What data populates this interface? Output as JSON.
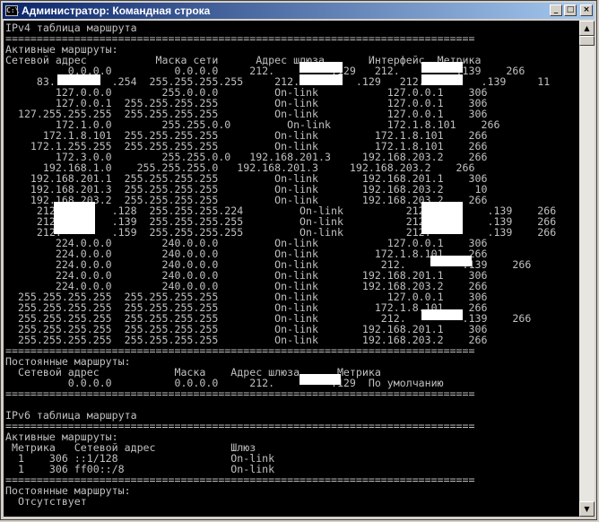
{
  "window": {
    "title": "Администратор: Командная строка",
    "icon_glyph": "C:\\",
    "icon": "console-icon",
    "buttons": {
      "minimize": "_",
      "maximize": "□",
      "close": "×"
    },
    "colors": {
      "titlebar_start": "#0a246a",
      "titlebar_end": "#a6caf0",
      "console_bg": "#000000",
      "console_text": "#c0c0c0",
      "redaction": "#ffffff"
    }
  },
  "scrollbar": {
    "up": "▲",
    "down": "▼"
  },
  "console": {
    "lines": [
      "IPv4 таблица маршрута",
      "===========================================================================",
      "Активные маршруты:",
      "Сетевой адрес           Маска сети      Адрес шлюза       Интерфейс  Метрика",
      "          0.0.0.0          0.0.0.0     212.         .129   212.         .139    266",
      "     83.         .254  255.255.255.255     212.         .129   212.         .139     11",
      "        127.0.0.0        255.0.0.0         On-link           127.0.0.1    306",
      "        127.0.0.1  255.255.255.255         On-link           127.0.0.1    306",
      "  127.255.255.255  255.255.255.255         On-link           127.0.0.1    306",
      "        172.1.0.0        255.255.0.0         On-link         172.1.8.101    266",
      "      172.1.8.101  255.255.255.255         On-link         172.1.8.101    266",
      "    172.1.255.255  255.255.255.255         On-link         172.1.8.101    266",
      "        172.3.0.0        255.255.0.0   192.168.201.3     192.168.203.2    266",
      "      192.168.1.0    255.255.255.0   192.168.201.3     192.168.203.2    266",
      "    192.168.201.1  255.255.255.255         On-link       192.168.201.1    306",
      "    192.168.201.3  255.255.255.255         On-link       192.168.203.2     10",
      "    192.168.203.2  255.255.255.255         On-link       192.168.203.2    266",
      "     212.        .128  255.255.255.224         On-link          212.         .139    266",
      "     212.        .139  255.255.255.255         On-link          212.         .139    266",
      "     212.        .159  255.255.255.255         On-link          212.         .139    266",
      "        224.0.0.0        240.0.0.0         On-link           127.0.0.1    306",
      "        224.0.0.0        240.0.0.0         On-link         172.1.8.101    266",
      "        224.0.0.0        240.0.0.0         On-link          212.         .139    266",
      "        224.0.0.0        240.0.0.0         On-link       192.168.201.1    306",
      "        224.0.0.0        240.0.0.0         On-link       192.168.203.2    266",
      "  255.255.255.255  255.255.255.255         On-link           127.0.0.1    306",
      "  255.255.255.255  255.255.255.255         On-link         172.1.8.101    266",
      "  255.255.255.255  255.255.255.255         On-link          212.         .139    266",
      "  255.255.255.255  255.255.255.255         On-link       192.168.201.1    306",
      "  255.255.255.255  255.255.255.255         On-link       192.168.203.2    266",
      "===========================================================================",
      "Постоянные маршруты:",
      "  Сетевой адрес            Маска    Адрес шлюза      Метрика",
      "          0.0.0.0          0.0.0.0     212.         .129  По умолчанию",
      "===========================================================================",
      "",
      "IPv6 таблица маршрута",
      "===========================================================================",
      "Активные маршруты:",
      " Метрика   Сетевой адрес            Шлюз",
      "  1    306 ::1/128                  On-link",
      "  1    306 ff00::/8                 On-link",
      "===========================================================================",
      "Постоянные маршруты:",
      "  Отсутствует"
    ]
  }
}
